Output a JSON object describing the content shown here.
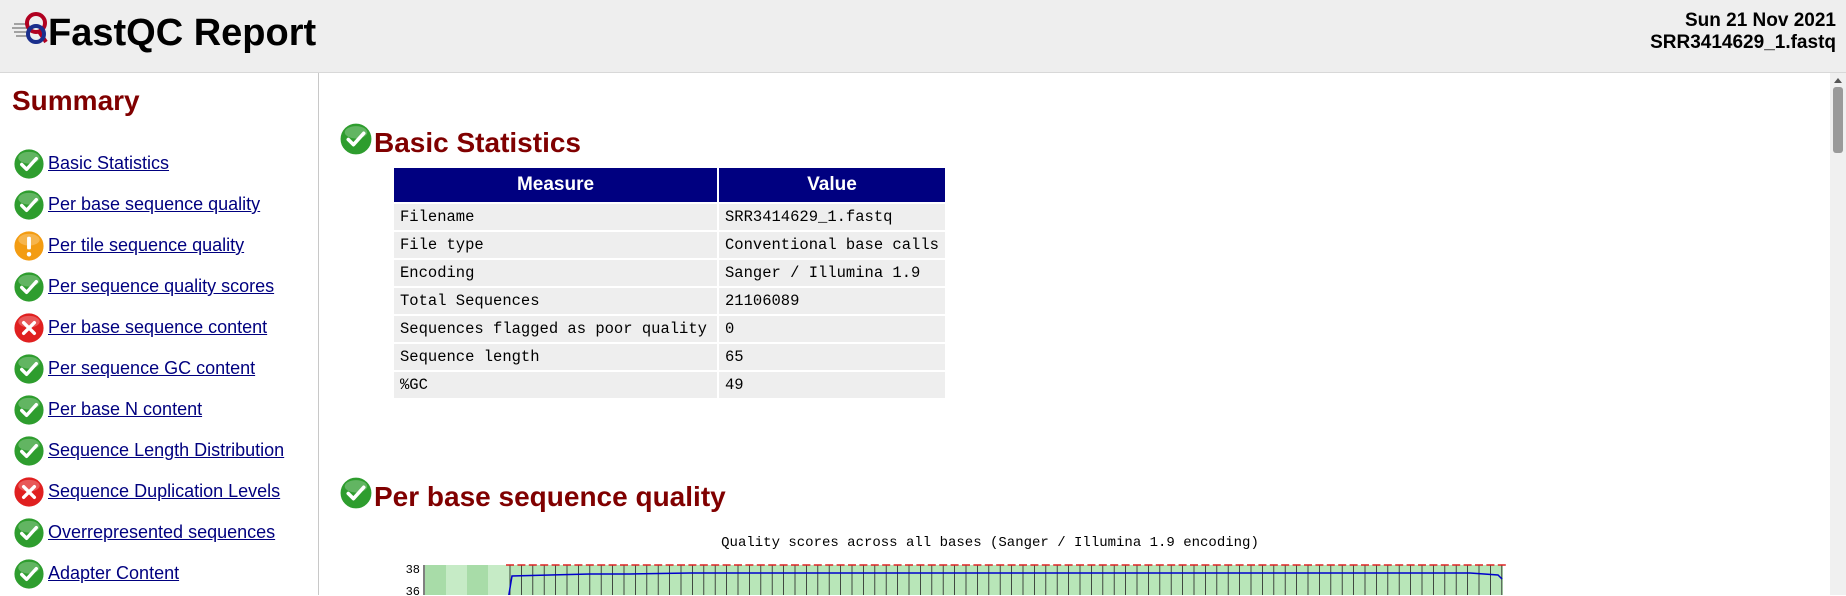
{
  "header": {
    "title": "FastQC Report",
    "date": "Sun 21 Nov 2021",
    "filename": "SRR3414629_1.fastq"
  },
  "sidebar": {
    "heading": "Summary",
    "items": [
      {
        "label": "Basic Statistics",
        "status": "pass"
      },
      {
        "label": "Per base sequence quality",
        "status": "pass"
      },
      {
        "label": "Per tile sequence quality",
        "status": "warn"
      },
      {
        "label": "Per sequence quality scores",
        "status": "pass"
      },
      {
        "label": "Per base sequence content",
        "status": "fail"
      },
      {
        "label": "Per sequence GC content",
        "status": "pass"
      },
      {
        "label": "Per base N content",
        "status": "pass"
      },
      {
        "label": "Sequence Length Distribution",
        "status": "pass"
      },
      {
        "label": "Sequence Duplication Levels",
        "status": "fail"
      },
      {
        "label": "Overrepresented sequences",
        "status": "pass"
      },
      {
        "label": "Adapter Content",
        "status": "pass"
      }
    ]
  },
  "main": {
    "basic_stats": {
      "title": "Basic Statistics",
      "status": "pass",
      "columns": [
        "Measure",
        "Value"
      ],
      "rows": [
        [
          "Filename",
          "SRR3414629_1.fastq"
        ],
        [
          "File type",
          "Conventional base calls"
        ],
        [
          "Encoding",
          "Sanger / Illumina 1.9"
        ],
        [
          "Total Sequences",
          "21106089"
        ],
        [
          "Sequences flagged as poor quality",
          "0"
        ],
        [
          "Sequence length",
          "65"
        ],
        [
          "%GC",
          "49"
        ]
      ]
    },
    "per_base_quality": {
      "title": "Per base sequence quality",
      "status": "pass",
      "chart_title": "Quality scores across all bases (Sanger / Illumina 1.9 encoding)",
      "y_ticks": [
        "38",
        "36"
      ]
    }
  },
  "colors": {
    "heading": "#800000",
    "table_header": "#000080",
    "link": "#00007f",
    "pass": "#2e9d2e",
    "warn": "#f39c12",
    "fail": "#e02020"
  }
}
